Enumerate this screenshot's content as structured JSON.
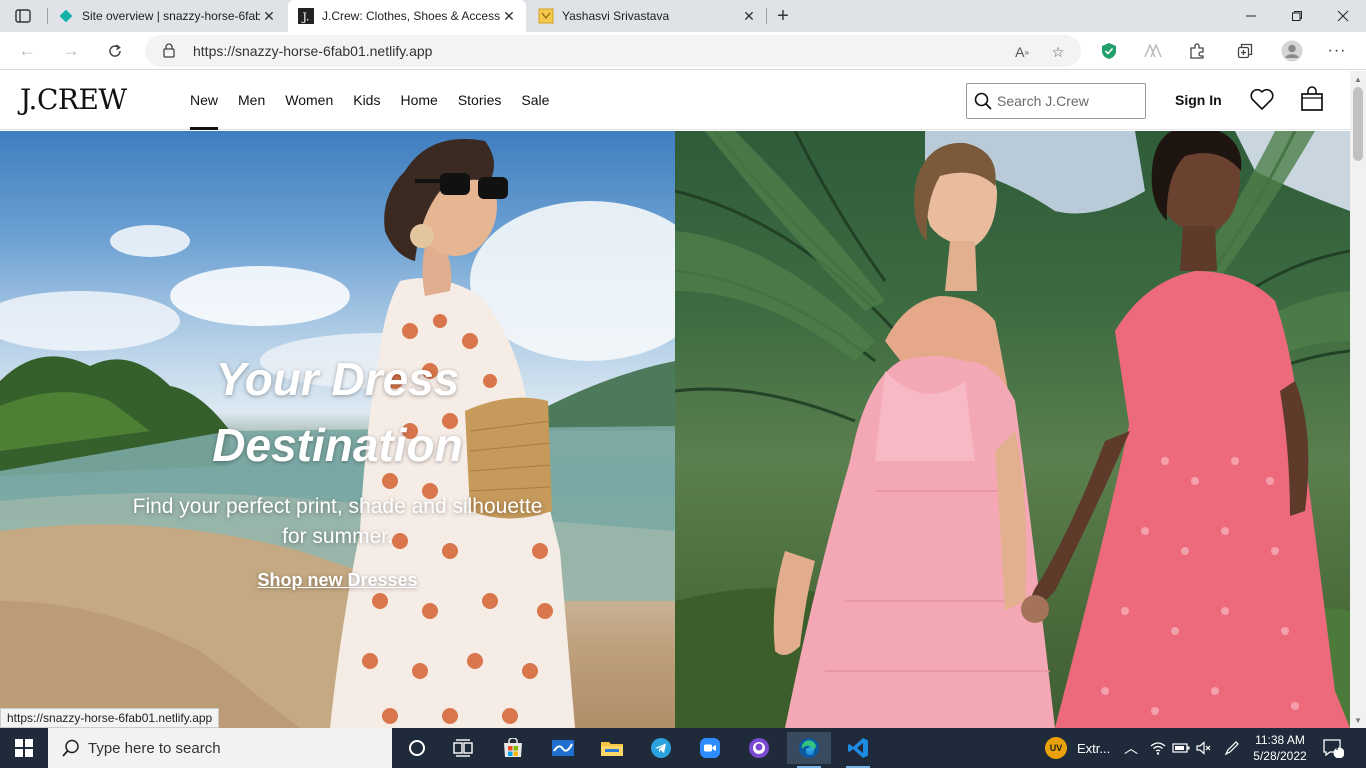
{
  "browser": {
    "tabs": [
      {
        "title": "Site overview | snazzy-horse-6fab",
        "favicon": "netlify-diamond-icon",
        "active": false
      },
      {
        "title": "J.Crew: Clothes, Shoes & Accesso",
        "favicon": "jcrew-j-icon",
        "active": true
      },
      {
        "title": "Yashasvi Srivastava",
        "favicon": "yellow-page-icon",
        "active": false
      }
    ],
    "url": "https://snazzy-horse-6fab01.netlify.app",
    "status_url": "https://snazzy-horse-6fab01.netlify.app"
  },
  "site": {
    "logo": "J.CREW",
    "nav": [
      "New",
      "Men",
      "Women",
      "Kids",
      "Home",
      "Stories",
      "Sale"
    ],
    "active_nav": "New",
    "search_placeholder": "Search J.Crew",
    "sign_in": "Sign In"
  },
  "hero": {
    "title_line1": "Your Dress",
    "title_line2": "Destination",
    "subtitle_line1": "Find your perfect print, shade and silhouette",
    "subtitle_line2": "for summer.",
    "cta": "Shop new Dresses"
  },
  "taskbar": {
    "search_placeholder": "Type here to search",
    "tray_app_label": "Extr...",
    "time": "11:38 AM",
    "date": "5/28/2022",
    "notification_count": "7"
  },
  "colors": {
    "taskbar_bg": "#1f2b3a",
    "tabstrip_bg": "#dfe3e8",
    "netlify_teal": "#14b1a6",
    "edge_blue": "#0c59a4",
    "telegram_blue": "#2aa3df",
    "zoom_blue": "#2d8cff",
    "vscode_blue": "#1e8be2",
    "shield_green": "#22a06b",
    "pink_dress": "#f4a7b5",
    "coral_dress": "#ec6a7c"
  }
}
